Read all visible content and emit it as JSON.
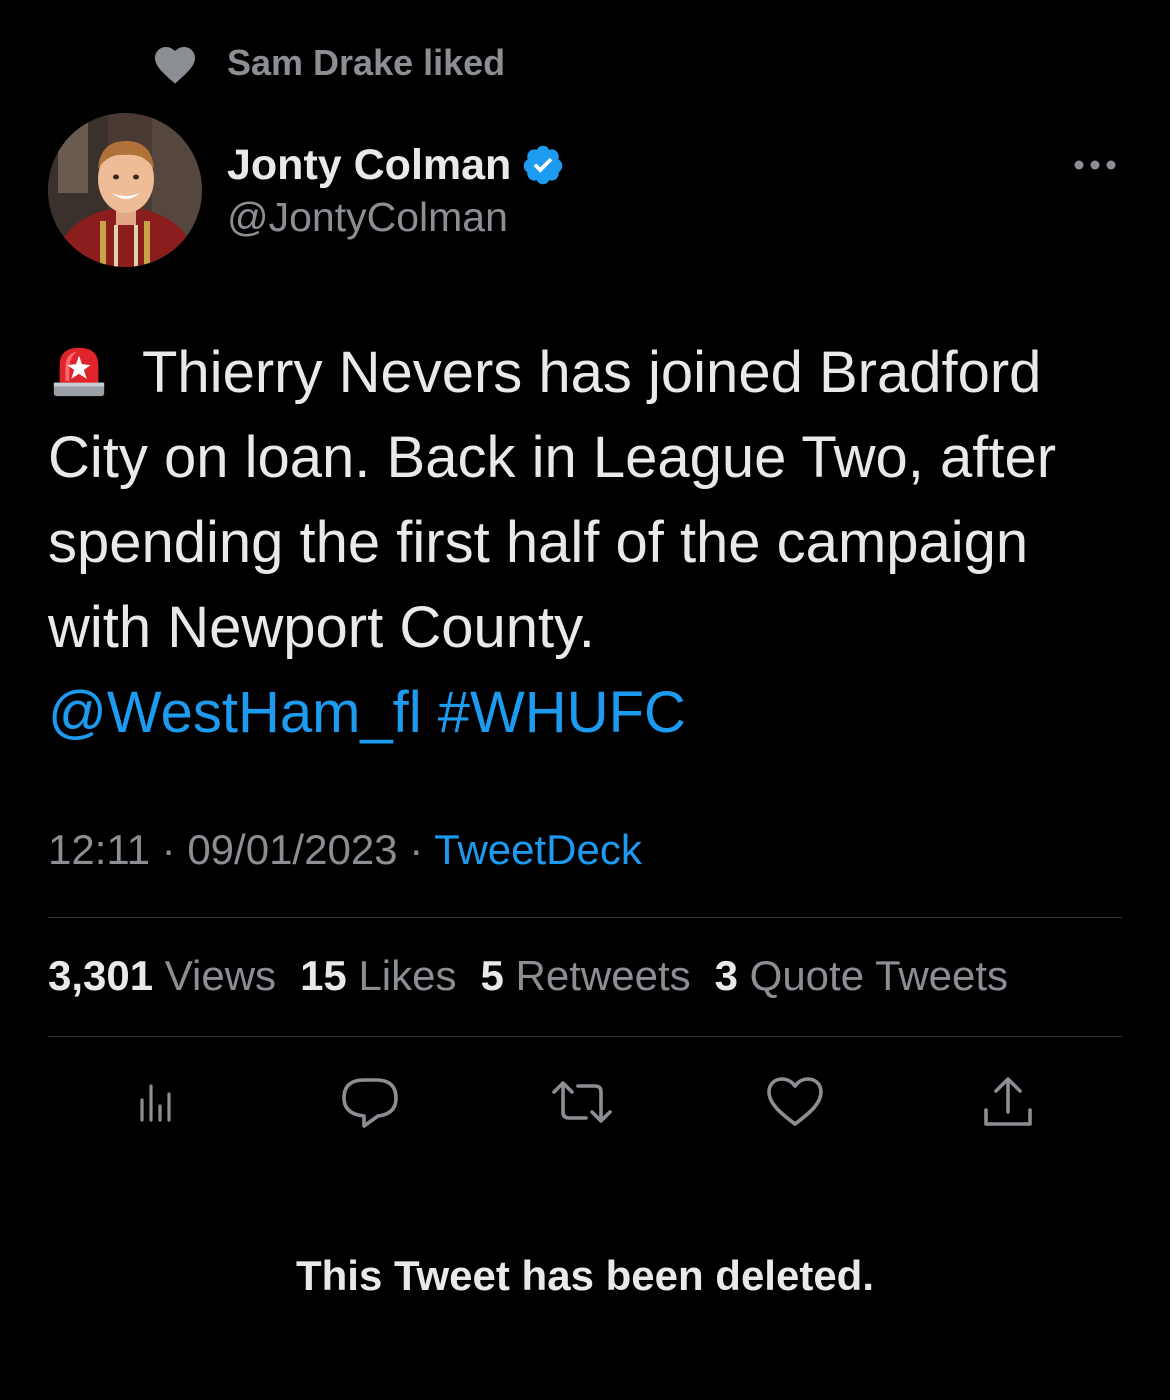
{
  "context": {
    "icon": "heart-icon",
    "text": "Sam Drake liked"
  },
  "author": {
    "display_name": "Jonty Colman",
    "handle": "@JontyColman",
    "verified": true,
    "verified_color": "#1d9bf0"
  },
  "tweet": {
    "emoji": "rotating-light-emoji",
    "text": "Thierry Nevers has joined Bradford City on loan. Back in League Two, after spending the first half of the campaign with Newport County.",
    "mention": "@WestHam_fl",
    "hashtag": "#WHUFC",
    "link_color": "#1d9bf0"
  },
  "meta": {
    "time": "12:11",
    "separator": " · ",
    "date": "09/01/2023",
    "source": "TweetDeck"
  },
  "stats": {
    "views_count": "3,301",
    "views_label": "Views",
    "likes_count": "15",
    "likes_label": "Likes",
    "retweets_count": "5",
    "retweets_label": "Retweets",
    "quotes_count": "3",
    "quotes_label": "Quote Tweets"
  },
  "actions": [
    {
      "name": "analytics-icon"
    },
    {
      "name": "reply-icon"
    },
    {
      "name": "retweet-icon"
    },
    {
      "name": "like-icon"
    },
    {
      "name": "share-icon"
    }
  ],
  "notice": {
    "text": "This Tweet has been deleted."
  }
}
